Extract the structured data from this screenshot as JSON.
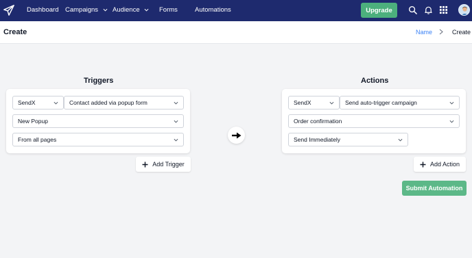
{
  "nav": {
    "items": [
      "Dashboard",
      "Campaigns",
      "Audience",
      "Forms",
      "Automations"
    ],
    "upgrade_label": "Upgrade",
    "icons": [
      "search-icon",
      "bell-icon",
      "grid-icon"
    ],
    "brand_color": "#1e2a6e",
    "upgrade_color": "#4caf7d"
  },
  "header": {
    "title": "Create",
    "breadcrumb": {
      "link": "Name",
      "current": "Create"
    }
  },
  "triggers": {
    "title": "Triggers",
    "source": "SendX",
    "event": "Contact added via popup form",
    "form": "New Popup",
    "pages": "From all pages",
    "add_label": "Add Trigger"
  },
  "actions": {
    "title": "Actions",
    "source": "SendX",
    "action": "Send auto-trigger campaign",
    "campaign": "Order confirmation",
    "timing": "Send Immediately",
    "add_label": "Add Action",
    "submit_label": "Submit Automation",
    "submit_color": "#5cb888"
  }
}
